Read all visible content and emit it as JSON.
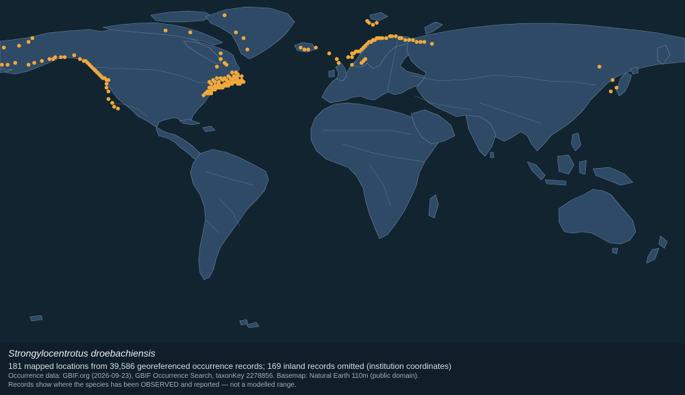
{
  "map": {
    "species_name": "Strongylocentrotus droebachiensis",
    "summary": "181 mapped locations from 39,586 georeferenced occurrence records; 169 inland records omitted (institution coordinates)",
    "source_note": "Occurrence data: GBIF.org (2026-09-23), GBIF Occurrence Search, taxonKey 2278856. Basemap: Natural Earth 110m (public domain).",
    "disclaimer": "Records show where the species has been OBSERVED and reported — not a modelled range.",
    "colors": {
      "ocean": "#12242f",
      "land": "#2f4a66",
      "border": "#6d89a6",
      "occurrence": "#f2a93b",
      "caption_bg": "#0f1e28"
    },
    "occurrences": [
      [
        -179,
        56
      ],
      [
        -176,
        56
      ],
      [
        -172,
        57
      ],
      [
        -165,
        56
      ],
      [
        -162,
        57
      ],
      [
        -158,
        58
      ],
      [
        -154,
        59
      ],
      [
        -152,
        59
      ],
      [
        -151,
        60
      ],
      [
        -148,
        60
      ],
      [
        -146,
        60
      ],
      [
        -141,
        61
      ],
      [
        -138,
        59
      ],
      [
        -136,
        58
      ],
      [
        -135,
        58
      ],
      [
        -134,
        57
      ],
      [
        -133,
        56
      ],
      [
        -132,
        55
      ],
      [
        -131,
        54
      ],
      [
        -130,
        53
      ],
      [
        -129,
        52
      ],
      [
        -128,
        51
      ],
      [
        -127,
        50
      ],
      [
        -126,
        49
      ],
      [
        -125,
        49
      ],
      [
        -124,
        48
      ],
      [
        -123,
        48
      ],
      [
        -124,
        46
      ],
      [
        -124,
        44
      ],
      [
        -123,
        42
      ],
      [
        -123,
        38
      ],
      [
        -121,
        36
      ],
      [
        -120,
        34
      ],
      [
        -118,
        33
      ],
      [
        -93,
        74
      ],
      [
        -80,
        73
      ],
      [
        -62,
        82
      ],
      [
        -56,
        73
      ],
      [
        -52,
        70
      ],
      [
        -50,
        64
      ],
      [
        -22,
        65
      ],
      [
        -20,
        64
      ],
      [
        -18,
        64
      ],
      [
        -14,
        65
      ],
      [
        -70,
        44
      ],
      [
        -69,
        44
      ],
      [
        -68,
        44
      ],
      [
        -67,
        45
      ],
      [
        -66,
        45
      ],
      [
        -65,
        46
      ],
      [
        -64,
        45
      ],
      [
        -63,
        44
      ],
      [
        -62,
        46
      ],
      [
        -61,
        46
      ],
      [
        -60,
        47
      ],
      [
        -59,
        47
      ],
      [
        -58,
        48
      ],
      [
        -57,
        49
      ],
      [
        -56,
        49
      ],
      [
        -55,
        48
      ],
      [
        -54,
        47
      ],
      [
        -53,
        47
      ],
      [
        -53,
        50
      ],
      [
        -55,
        51
      ],
      [
        -56,
        52
      ],
      [
        -58,
        52
      ],
      [
        -60,
        50
      ],
      [
        -62,
        49
      ],
      [
        -64,
        49
      ],
      [
        -66,
        49
      ],
      [
        -68,
        48
      ],
      [
        -70,
        47
      ],
      [
        -71,
        42
      ],
      [
        -70,
        42
      ],
      [
        -70,
        41
      ],
      [
        -69,
        41
      ],
      [
        -68,
        43
      ],
      [
        -67,
        43
      ],
      [
        -65,
        44
      ],
      [
        -64,
        44
      ],
      [
        -62,
        45
      ],
      [
        -60,
        45
      ],
      [
        -58,
        46
      ],
      [
        -56,
        47
      ],
      [
        -55,
        46
      ],
      [
        -61,
        56
      ],
      [
        -62,
        57
      ],
      [
        -64,
        59
      ],
      [
        -64,
        62
      ],
      [
        -66,
        55
      ],
      [
        -72,
        41
      ],
      [
        -73,
        40
      ],
      [
        -71,
        41
      ],
      [
        -69,
        42
      ],
      [
        -67,
        44
      ],
      [
        -66,
        44
      ],
      [
        -63,
        45
      ],
      [
        -61,
        45
      ],
      [
        -59,
        46
      ],
      [
        -57,
        47
      ],
      [
        -54,
        46
      ],
      [
        -52,
        47
      ],
      [
        -53,
        48
      ],
      [
        -55,
        50
      ],
      [
        -57,
        50
      ],
      [
        -59,
        49
      ],
      [
        -61,
        48
      ],
      [
        -63,
        48
      ],
      [
        -65,
        47
      ],
      [
        -67,
        47
      ],
      [
        -69,
        46
      ],
      [
        -7,
        62
      ],
      [
        -3,
        59
      ],
      [
        -2,
        57
      ],
      [
        3,
        60
      ],
      [
        5,
        60
      ],
      [
        5,
        62
      ],
      [
        6,
        62
      ],
      [
        7,
        63
      ],
      [
        8,
        63
      ],
      [
        9,
        63
      ],
      [
        10,
        64
      ],
      [
        11,
        65
      ],
      [
        12,
        66
      ],
      [
        13,
        67
      ],
      [
        14,
        68
      ],
      [
        15,
        68
      ],
      [
        16,
        69
      ],
      [
        17,
        69
      ],
      [
        18,
        70
      ],
      [
        19,
        70
      ],
      [
        20,
        70
      ],
      [
        21,
        70
      ],
      [
        23,
        70
      ],
      [
        25,
        71
      ],
      [
        26,
        71
      ],
      [
        28,
        71
      ],
      [
        30,
        70
      ],
      [
        31,
        70
      ],
      [
        33,
        69
      ],
      [
        35,
        69
      ],
      [
        37,
        69
      ],
      [
        39,
        68
      ],
      [
        41,
        68
      ],
      [
        43,
        68
      ],
      [
        47,
        67
      ],
      [
        10,
        57
      ],
      [
        11,
        58
      ],
      [
        12,
        59
      ],
      [
        16,
        77
      ],
      [
        18,
        78
      ],
      [
        14,
        78
      ],
      [
        13,
        79
      ],
      [
        5,
        56
      ],
      [
        135,
        55
      ],
      [
        142,
        48
      ],
      [
        144,
        44
      ],
      [
        141,
        42
      ],
      [
        -178,
        65
      ],
      [
        -170,
        66
      ],
      [
        -165,
        68
      ],
      [
        -163,
        70
      ]
    ]
  }
}
